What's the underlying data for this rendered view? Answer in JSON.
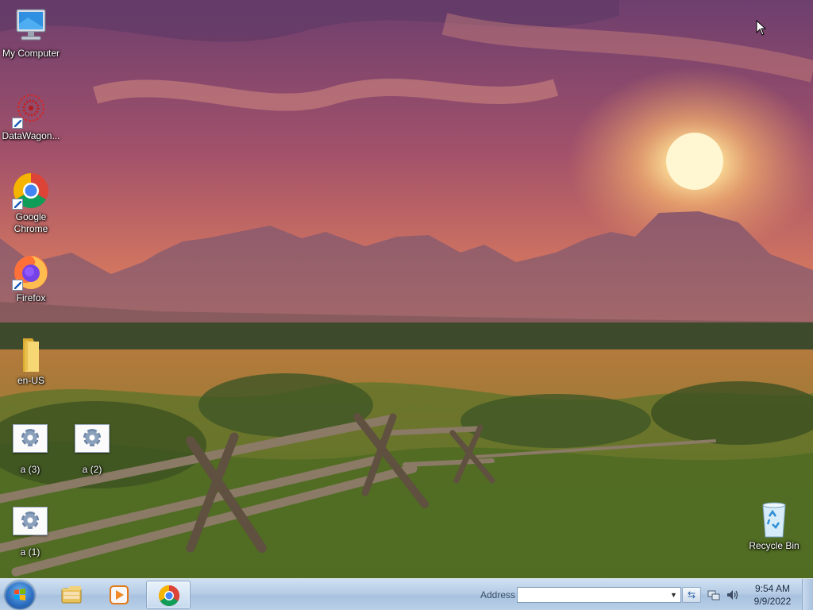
{
  "desktop": {
    "icons": [
      {
        "label": "My Computer",
        "icon": "computer-icon"
      },
      {
        "label": "DataWagon...",
        "icon": "datawagon-icon"
      },
      {
        "label": "Google Chrome",
        "icon": "chrome-icon"
      },
      {
        "label": "Firefox",
        "icon": "firefox-icon"
      },
      {
        "label": "en-US",
        "icon": "folder-icon"
      },
      {
        "label": "a (3)",
        "icon": "app-gear-icon"
      },
      {
        "label": "a (2)",
        "icon": "app-gear-icon"
      },
      {
        "label": "a (1)",
        "icon": "app-gear-icon"
      },
      {
        "label": "Recycle Bin",
        "icon": "recycle-bin-icon"
      }
    ]
  },
  "taskbar": {
    "start_icon": "windows-flag-icon",
    "pinned": [
      {
        "name": "Windows Explorer",
        "icon": "folder-explorer-icon",
        "active": false
      },
      {
        "name": "Media Player",
        "icon": "media-player-icon",
        "active": false
      },
      {
        "name": "Google Chrome",
        "icon": "chrome-icon",
        "active": true
      }
    ],
    "address": {
      "label": "Address",
      "value": ""
    },
    "tray": {
      "icons": [
        "network-icon",
        "volume-icon"
      ],
      "time": "9:54 AM",
      "date": "9/9/2022"
    }
  },
  "colors": {
    "taskbar": "#b6cde6",
    "sky_top": "#6b3f6d",
    "sun": "#fff4c8",
    "grass": "#7c8a2e"
  }
}
